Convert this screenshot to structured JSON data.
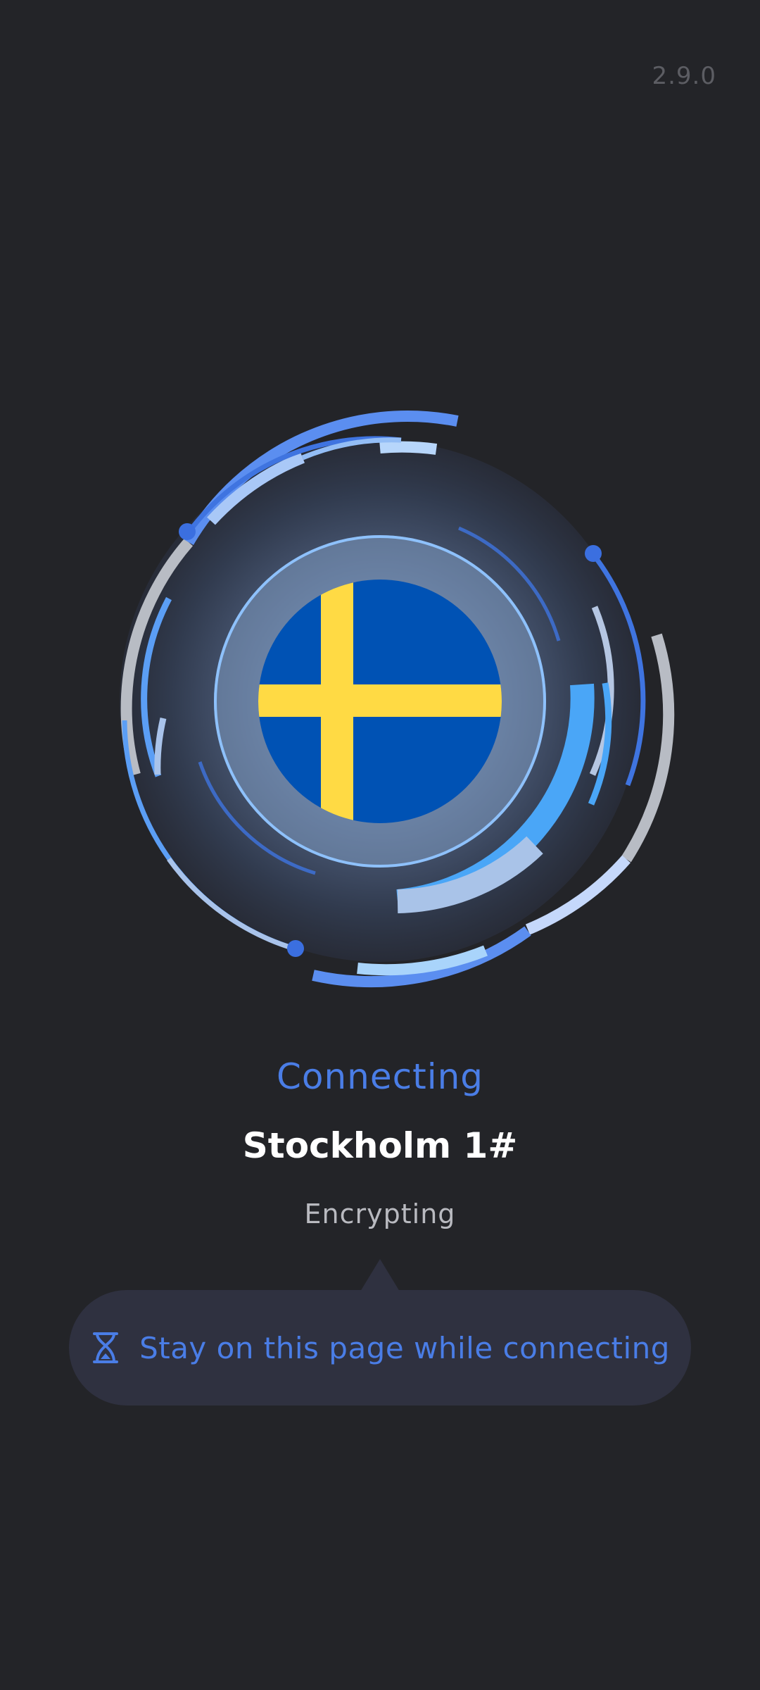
{
  "app": {
    "version": "2.9.0"
  },
  "connection": {
    "status": "Connecting",
    "server_name": "Stockholm 1#",
    "stage": "Encrypting",
    "country_flag_icon": "sweden-flag-icon"
  },
  "tooltip": {
    "icon": "hourglass-icon",
    "message": "Stay on this page while connecting"
  },
  "colors": {
    "background": "#232428",
    "accent": "#4a7de6",
    "flag_blue": "#0052b4",
    "flag_yellow": "#ffda44",
    "tooltip_bg": "#2f3140"
  }
}
